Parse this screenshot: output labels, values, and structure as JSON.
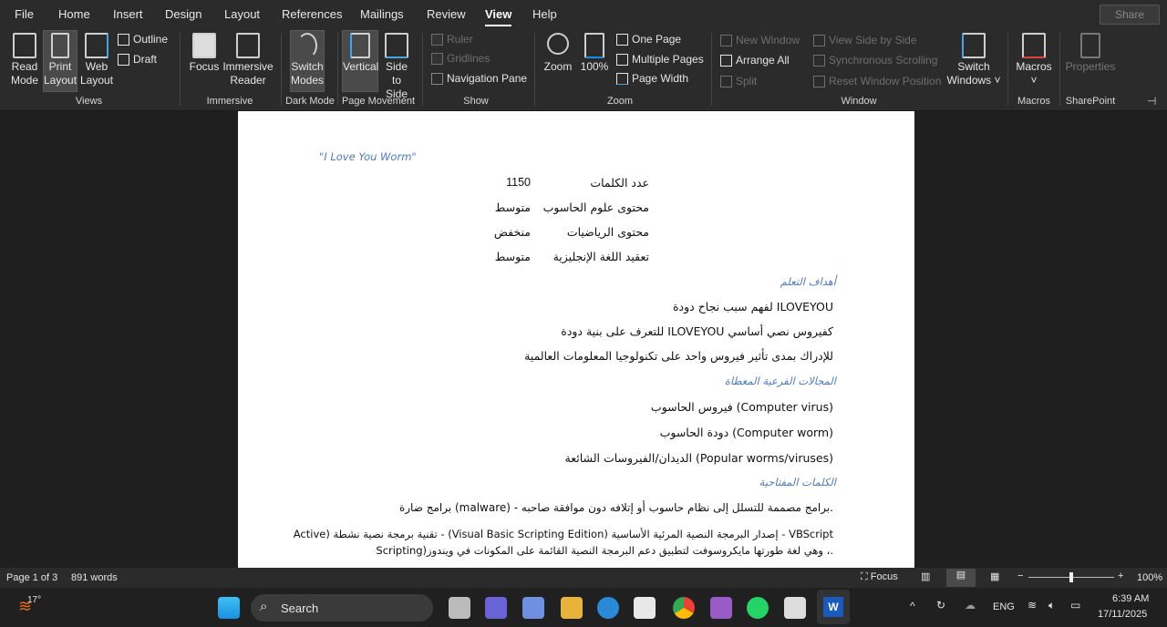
{
  "menu": {
    "tabs": [
      "File",
      "Home",
      "Insert",
      "Design",
      "Layout",
      "References",
      "Mailings",
      "Review",
      "View",
      "Help"
    ],
    "active": "View",
    "share": "Share"
  },
  "ribbon": {
    "views": {
      "read_mode": "Read Mode",
      "print_layout": "Print Layout",
      "web_layout": "Web Layout",
      "outline": "Outline",
      "draft": "Draft",
      "label": "Views"
    },
    "immersive": {
      "focus": "Focus",
      "reader": "Immersive Reader",
      "label": "Immersive"
    },
    "dark": {
      "switch": "Switch Modes",
      "label": "Dark Mode"
    },
    "movement": {
      "vertical": "Vertical",
      "side": "Side to Side",
      "label": "Page Movement"
    },
    "show": {
      "ruler": "Ruler",
      "gridlines": "Gridlines",
      "nav": "Navigation Pane",
      "label": "Show"
    },
    "zoom": {
      "zoom": "Zoom",
      "pct": "100%",
      "one": "One Page",
      "multi": "Multiple Pages",
      "width": "Page Width",
      "label": "Zoom"
    },
    "window": {
      "new": "New Window",
      "arrange": "Arrange All",
      "split": "Split",
      "side": "View Side by Side",
      "sync": "Synchronous Scrolling",
      "reset": "Reset Window Position",
      "switch": "Switch Windows",
      "label": "Window"
    },
    "macros": {
      "macros": "Macros",
      "label": "Macros"
    },
    "sharepoint": {
      "props": "Properties",
      "label": "SharePoint"
    }
  },
  "doc": {
    "title": "\"I Love You Worm\"",
    "table": [
      {
        "k": "عدد الكلمات",
        "v": "1150"
      },
      {
        "k": "محتوى علوم الحاسوب",
        "v": "متوسط"
      },
      {
        "k": "محتوى الرياضيات",
        "v": "منخفض"
      },
      {
        "k": "تعقيد اللغة الإنجليزية",
        "v": "متوسط"
      }
    ],
    "h1": "أهداف التعلم",
    "goals": [
      "ILOVEYOU لفهم سبب نجاح دودة",
      "كفيروس نصي أساسي ILOVEYOU للتعرف على بنية دودة",
      "للإدراك بمدى تأثير فيروس واحد على تكنولوجيا المعلومات العالمية"
    ],
    "h2": "المجالات الفرعية المغطاة",
    "areas": [
      "(Computer virus) فيروس الحاسوب",
      "(Computer worm) دودة الحاسوب",
      "(Popular worms/viruses) الديدان/الفيروسات الشائعة"
    ],
    "h3": "الكلمات المفتاحية",
    "kw1": ".برامج مصممة للتسلل إلى نظام حاسوب أو إتلافه دون موافقة صاحبه - (malware) برامج ضارة",
    "kw2a": "VBScript - إصدار البرمجة النصية المرئية الأساسية (Visual Basic Scripting Edition) - تقنية برمجة نصية نشطة (Active",
    "kw2b": ".، وهي لغة طورتها مايكروسوفت لتطبيق دعم البرمجة النصية القائمة على المكونات في ويندوز(Scripting"
  },
  "status": {
    "page": "Page 1 of 3",
    "words": "891 words",
    "focus": "Focus",
    "zoom": "100%",
    "zoom_level": 100
  },
  "taskbar": {
    "temp": "17°",
    "search": "Search",
    "lang": "ENG",
    "time": "6:39 AM",
    "date": "17/11/2025"
  },
  "colors": {
    "accent": "#4f7ac4",
    "ribbon": "#2b2b2b"
  }
}
